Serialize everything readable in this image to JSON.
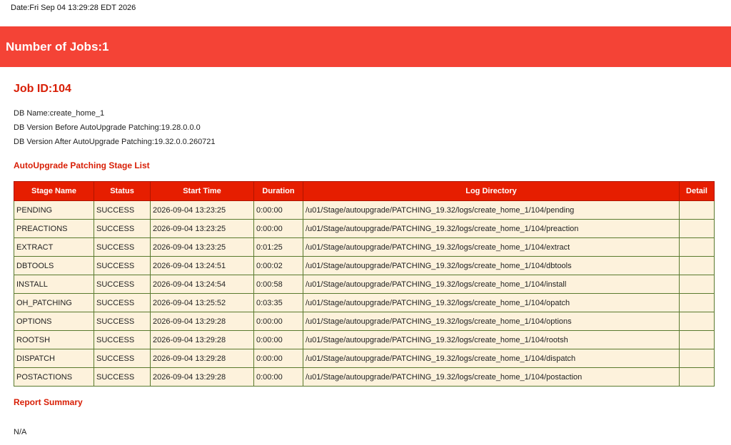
{
  "report": {
    "date_line": "Date:Fri Sep 04 13:29:28 EDT 2026",
    "jobs_count_title": "Number of Jobs:1"
  },
  "job": {
    "title": "Job ID:104",
    "db_name": "DB Name:create_home_1",
    "version_before": "DB Version Before AutoUpgrade Patching:19.28.0.0.0",
    "version_after": "DB Version After AutoUpgrade Patching:19.32.0.0.260721"
  },
  "stage_list": {
    "title": "AutoUpgrade Patching Stage List",
    "columns": [
      "Stage Name",
      "Status",
      "Start Time",
      "Duration",
      "Log Directory",
      "Detail"
    ],
    "rows": [
      {
        "stage": "PENDING",
        "status": "SUCCESS",
        "start": "2026-09-04 13:23:25",
        "duration": "0:00:00",
        "log": "/u01/Stage/autoupgrade/PATCHING_19.32/logs/create_home_1/104/pending",
        "detail": ""
      },
      {
        "stage": "PREACTIONS",
        "status": "SUCCESS",
        "start": "2026-09-04 13:23:25",
        "duration": "0:00:00",
        "log": "/u01/Stage/autoupgrade/PATCHING_19.32/logs/create_home_1/104/preaction",
        "detail": ""
      },
      {
        "stage": "EXTRACT",
        "status": "SUCCESS",
        "start": "2026-09-04 13:23:25",
        "duration": "0:01:25",
        "log": "/u01/Stage/autoupgrade/PATCHING_19.32/logs/create_home_1/104/extract",
        "detail": ""
      },
      {
        "stage": "DBTOOLS",
        "status": "SUCCESS",
        "start": "2026-09-04 13:24:51",
        "duration": "0:00:02",
        "log": "/u01/Stage/autoupgrade/PATCHING_19.32/logs/create_home_1/104/dbtools",
        "detail": ""
      },
      {
        "stage": "INSTALL",
        "status": "SUCCESS",
        "start": "2026-09-04 13:24:54",
        "duration": "0:00:58",
        "log": "/u01/Stage/autoupgrade/PATCHING_19.32/logs/create_home_1/104/install",
        "detail": ""
      },
      {
        "stage": "OH_PATCHING",
        "status": "SUCCESS",
        "start": "2026-09-04 13:25:52",
        "duration": "0:03:35",
        "log": "/u01/Stage/autoupgrade/PATCHING_19.32/logs/create_home_1/104/opatch",
        "detail": ""
      },
      {
        "stage": "OPTIONS",
        "status": "SUCCESS",
        "start": "2026-09-04 13:29:28",
        "duration": "0:00:00",
        "log": "/u01/Stage/autoupgrade/PATCHING_19.32/logs/create_home_1/104/options",
        "detail": ""
      },
      {
        "stage": "ROOTSH",
        "status": "SUCCESS",
        "start": "2026-09-04 13:29:28",
        "duration": "0:00:00",
        "log": "/u01/Stage/autoupgrade/PATCHING_19.32/logs/create_home_1/104/rootsh",
        "detail": ""
      },
      {
        "stage": "DISPATCH",
        "status": "SUCCESS",
        "start": "2026-09-04 13:29:28",
        "duration": "0:00:00",
        "log": "/u01/Stage/autoupgrade/PATCHING_19.32/logs/create_home_1/104/dispatch",
        "detail": ""
      },
      {
        "stage": "POSTACTIONS",
        "status": "SUCCESS",
        "start": "2026-09-04 13:29:28",
        "duration": "0:00:00",
        "log": "/u01/Stage/autoupgrade/PATCHING_19.32/logs/create_home_1/104/postaction",
        "detail": ""
      }
    ]
  },
  "summary": {
    "title": "Report Summary",
    "value": "N/A"
  },
  "colors": {
    "banner": "#f44336",
    "heading_red": "#d81e05",
    "table_header": "#e61e00",
    "row_background": "#fdf2dc",
    "row_border": "#5a7a2e"
  }
}
